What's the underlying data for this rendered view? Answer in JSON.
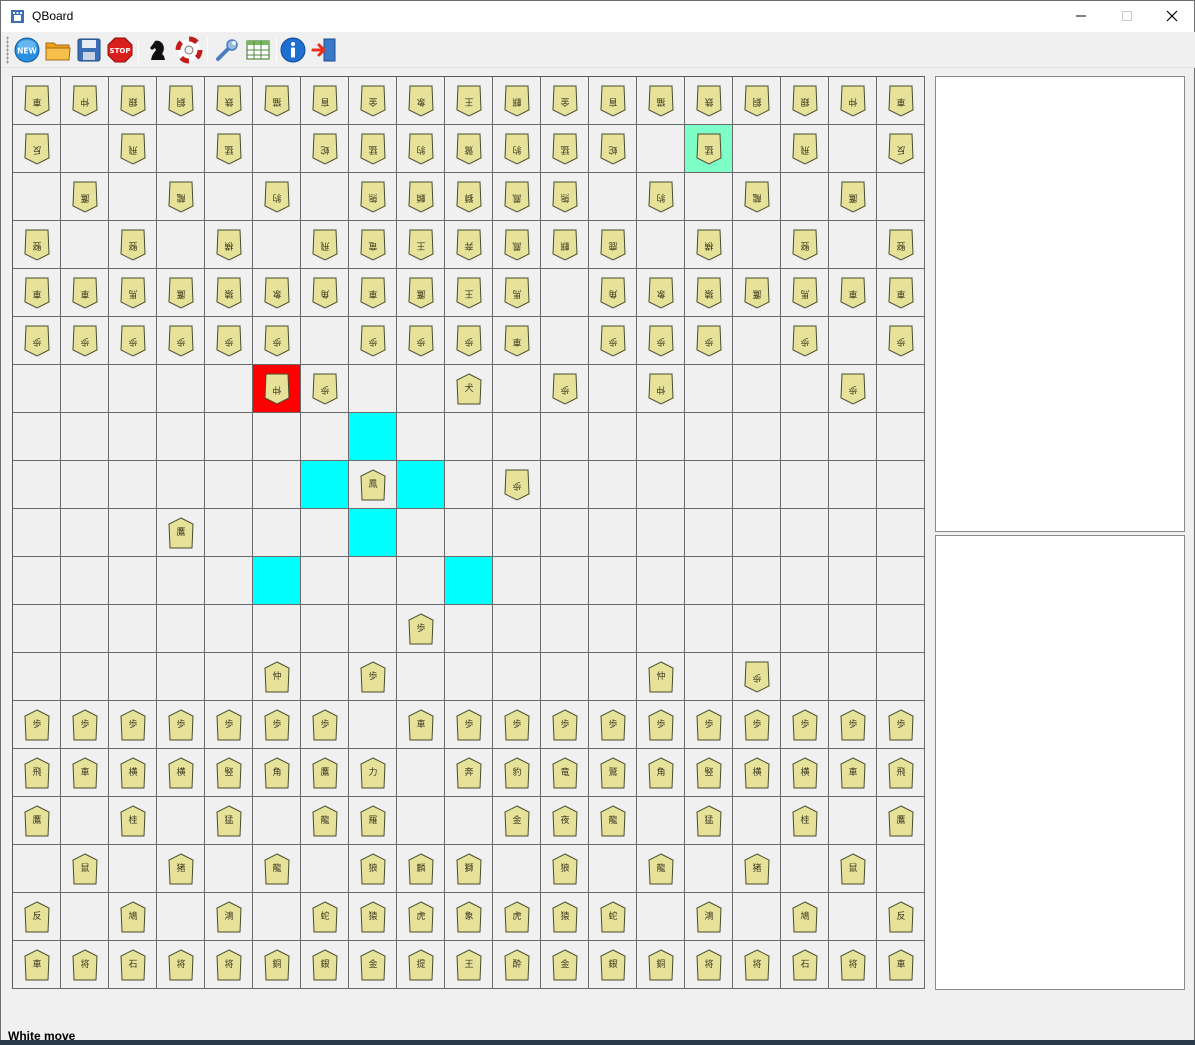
{
  "window": {
    "title": "QBoard",
    "buttons": [
      "minimize",
      "maximize",
      "close"
    ]
  },
  "toolbar": {
    "buttons": [
      {
        "name": "new-game-button",
        "icon": "new-icon",
        "label": "NEW"
      },
      {
        "name": "open-button",
        "icon": "folder-icon"
      },
      {
        "name": "save-button",
        "icon": "save-icon"
      },
      {
        "name": "stop-button",
        "icon": "stop-icon",
        "label": "STOP"
      },
      {
        "name": "engine-button",
        "icon": "knight-icon"
      },
      {
        "name": "flip-button",
        "icon": "lifebuoy-icon"
      },
      {
        "name": "settings-button",
        "icon": "wrench-icon"
      },
      {
        "name": "table-button",
        "icon": "table-icon"
      },
      {
        "name": "about-button",
        "icon": "info-icon"
      },
      {
        "name": "exit-button",
        "icon": "exit-icon"
      }
    ]
  },
  "board": {
    "files": 19,
    "ranks": 19,
    "highlights": {
      "cyan": [
        [
          7,
          7
        ],
        [
          8,
          6
        ],
        [
          8,
          8
        ],
        [
          9,
          7
        ],
        [
          10,
          5
        ],
        [
          10,
          9
        ]
      ],
      "red": [
        [
          6,
          5
        ]
      ],
      "green": [
        [
          1,
          14
        ]
      ]
    },
    "pieces": [
      {
        "r": 0,
        "c": 0,
        "s": "w",
        "k": "車"
      },
      {
        "r": 0,
        "c": 1,
        "s": "w",
        "k": "仲"
      },
      {
        "r": 0,
        "c": 2,
        "s": "w",
        "k": "銀"
      },
      {
        "r": 0,
        "c": 3,
        "s": "w",
        "k": "銅"
      },
      {
        "r": 0,
        "c": 4,
        "s": "w",
        "k": "鉄"
      },
      {
        "r": 0,
        "c": 5,
        "s": "w",
        "k": "猫"
      },
      {
        "r": 0,
        "c": 6,
        "s": "w",
        "k": "盲"
      },
      {
        "r": 0,
        "c": 7,
        "s": "w",
        "k": "金"
      },
      {
        "r": 0,
        "c": 8,
        "s": "w",
        "k": "象"
      },
      {
        "r": 0,
        "c": 9,
        "s": "w",
        "k": "王"
      },
      {
        "r": 0,
        "c": 10,
        "s": "w",
        "k": "麒"
      },
      {
        "r": 0,
        "c": 11,
        "s": "w",
        "k": "金"
      },
      {
        "r": 0,
        "c": 12,
        "s": "w",
        "k": "盲"
      },
      {
        "r": 0,
        "c": 13,
        "s": "w",
        "k": "猫"
      },
      {
        "r": 0,
        "c": 14,
        "s": "w",
        "k": "鉄"
      },
      {
        "r": 0,
        "c": 15,
        "s": "w",
        "k": "銅"
      },
      {
        "r": 0,
        "c": 16,
        "s": "w",
        "k": "銀"
      },
      {
        "r": 0,
        "c": 17,
        "s": "w",
        "k": "仲"
      },
      {
        "r": 0,
        "c": 18,
        "s": "w",
        "k": "車"
      },
      {
        "r": 1,
        "c": 0,
        "s": "w",
        "k": "反"
      },
      {
        "r": 1,
        "c": 2,
        "s": "w",
        "k": "飛"
      },
      {
        "r": 1,
        "c": 4,
        "s": "w",
        "k": "猛"
      },
      {
        "r": 1,
        "c": 6,
        "s": "w",
        "k": "蛇"
      },
      {
        "r": 1,
        "c": 7,
        "s": "w",
        "k": "猛"
      },
      {
        "r": 1,
        "c": 8,
        "s": "w",
        "k": "豹"
      },
      {
        "r": 1,
        "c": 9,
        "s": "w",
        "k": "鷲"
      },
      {
        "r": 1,
        "c": 10,
        "s": "w",
        "k": "豹"
      },
      {
        "r": 1,
        "c": 11,
        "s": "w",
        "k": "猛"
      },
      {
        "r": 1,
        "c": 12,
        "s": "w",
        "k": "蛇"
      },
      {
        "r": 1,
        "c": 14,
        "s": "w",
        "k": "猛"
      },
      {
        "r": 1,
        "c": 16,
        "s": "w",
        "k": "飛"
      },
      {
        "r": 1,
        "c": 18,
        "s": "w",
        "k": "反"
      },
      {
        "r": 2,
        "c": 1,
        "s": "w",
        "k": "鷹"
      },
      {
        "r": 2,
        "c": 3,
        "s": "w",
        "k": "龍"
      },
      {
        "r": 2,
        "c": 5,
        "s": "w",
        "k": "豹"
      },
      {
        "r": 2,
        "c": 7,
        "s": "w",
        "k": "熊"
      },
      {
        "r": 2,
        "c": 8,
        "s": "w",
        "k": "麟"
      },
      {
        "r": 2,
        "c": 9,
        "s": "w",
        "k": "獅"
      },
      {
        "r": 2,
        "c": 10,
        "s": "w",
        "k": "鳳"
      },
      {
        "r": 2,
        "c": 11,
        "s": "w",
        "k": "熊"
      },
      {
        "r": 2,
        "c": 13,
        "s": "w",
        "k": "豹"
      },
      {
        "r": 2,
        "c": 15,
        "s": "w",
        "k": "龍"
      },
      {
        "r": 2,
        "c": 17,
        "s": "w",
        "k": "鷹"
      },
      {
        "r": 3,
        "c": 0,
        "s": "w",
        "k": "竪"
      },
      {
        "r": 3,
        "c": 2,
        "s": "w",
        "k": "竪"
      },
      {
        "r": 3,
        "c": 4,
        "s": "w",
        "k": "横"
      },
      {
        "r": 3,
        "c": 6,
        "s": "w",
        "k": "飛"
      },
      {
        "r": 3,
        "c": 7,
        "s": "w",
        "k": "竜"
      },
      {
        "r": 3,
        "c": 8,
        "s": "w",
        "k": "王"
      },
      {
        "r": 3,
        "c": 9,
        "s": "w",
        "k": "奔"
      },
      {
        "r": 3,
        "c": 10,
        "s": "w",
        "k": "鳳"
      },
      {
        "r": 3,
        "c": 11,
        "s": "w",
        "k": "麒"
      },
      {
        "r": 3,
        "c": 12,
        "s": "w",
        "k": "鹿"
      },
      {
        "r": 3,
        "c": 14,
        "s": "w",
        "k": "横"
      },
      {
        "r": 3,
        "c": 16,
        "s": "w",
        "k": "竪"
      },
      {
        "r": 3,
        "c": 18,
        "s": "w",
        "k": "竪"
      },
      {
        "r": 4,
        "c": 0,
        "s": "w",
        "k": "車"
      },
      {
        "r": 4,
        "c": 1,
        "s": "w",
        "k": "車"
      },
      {
        "r": 4,
        "c": 2,
        "s": "w",
        "k": "馬"
      },
      {
        "r": 4,
        "c": 3,
        "s": "w",
        "k": "鷹"
      },
      {
        "r": 4,
        "c": 4,
        "s": "w",
        "k": "猿"
      },
      {
        "r": 4,
        "c": 5,
        "s": "w",
        "k": "象"
      },
      {
        "r": 4,
        "c": 6,
        "s": "w",
        "k": "角"
      },
      {
        "r": 4,
        "c": 7,
        "s": "w",
        "k": "車"
      },
      {
        "r": 4,
        "c": 8,
        "s": "w",
        "k": "鷹"
      },
      {
        "r": 4,
        "c": 9,
        "s": "w",
        "k": "王"
      },
      {
        "r": 4,
        "c": 10,
        "s": "w",
        "k": "馬"
      },
      {
        "r": 4,
        "c": 12,
        "s": "w",
        "k": "角"
      },
      {
        "r": 4,
        "c": 13,
        "s": "w",
        "k": "象"
      },
      {
        "r": 4,
        "c": 14,
        "s": "w",
        "k": "猿"
      },
      {
        "r": 4,
        "c": 15,
        "s": "w",
        "k": "鷹"
      },
      {
        "r": 4,
        "c": 16,
        "s": "w",
        "k": "馬"
      },
      {
        "r": 4,
        "c": 17,
        "s": "w",
        "k": "車"
      },
      {
        "r": 4,
        "c": 18,
        "s": "w",
        "k": "車"
      },
      {
        "r": 5,
        "c": 0,
        "s": "w",
        "k": "歩"
      },
      {
        "r": 5,
        "c": 1,
        "s": "w",
        "k": "歩"
      },
      {
        "r": 5,
        "c": 2,
        "s": "w",
        "k": "歩"
      },
      {
        "r": 5,
        "c": 3,
        "s": "w",
        "k": "歩"
      },
      {
        "r": 5,
        "c": 4,
        "s": "w",
        "k": "歩"
      },
      {
        "r": 5,
        "c": 5,
        "s": "w",
        "k": "歩"
      },
      {
        "r": 5,
        "c": 7,
        "s": "w",
        "k": "歩"
      },
      {
        "r": 5,
        "c": 8,
        "s": "w",
        "k": "歩"
      },
      {
        "r": 5,
        "c": 9,
        "s": "w",
        "k": "歩"
      },
      {
        "r": 5,
        "c": 10,
        "s": "w",
        "k": "車"
      },
      {
        "r": 5,
        "c": 12,
        "s": "w",
        "k": "歩"
      },
      {
        "r": 5,
        "c": 13,
        "s": "w",
        "k": "歩"
      },
      {
        "r": 5,
        "c": 14,
        "s": "w",
        "k": "歩"
      },
      {
        "r": 5,
        "c": 16,
        "s": "w",
        "k": "歩"
      },
      {
        "r": 5,
        "c": 18,
        "s": "w",
        "k": "歩"
      },
      {
        "r": 6,
        "c": 5,
        "s": "w",
        "k": "仲"
      },
      {
        "r": 6,
        "c": 6,
        "s": "w",
        "k": "歩"
      },
      {
        "r": 6,
        "c": 9,
        "s": "b",
        "k": "犬"
      },
      {
        "r": 6,
        "c": 11,
        "s": "w",
        "k": "歩"
      },
      {
        "r": 6,
        "c": 13,
        "s": "w",
        "k": "仲"
      },
      {
        "r": 6,
        "c": 17,
        "s": "w",
        "k": "歩"
      },
      {
        "r": 8,
        "c": 7,
        "s": "b",
        "k": "鳳"
      },
      {
        "r": 8,
        "c": 10,
        "s": "w",
        "k": "歩"
      },
      {
        "r": 9,
        "c": 3,
        "s": "b",
        "k": "鷹"
      },
      {
        "r": 11,
        "c": 8,
        "s": "b",
        "k": "歩"
      },
      {
        "r": 12,
        "c": 5,
        "s": "b",
        "k": "仲"
      },
      {
        "r": 12,
        "c": 7,
        "s": "b",
        "k": "歩"
      },
      {
        "r": 12,
        "c": 13,
        "s": "b",
        "k": "仲"
      },
      {
        "r": 12,
        "c": 15,
        "s": "w",
        "k": "歩"
      },
      {
        "r": 13,
        "c": 0,
        "s": "b",
        "k": "歩"
      },
      {
        "r": 13,
        "c": 1,
        "s": "b",
        "k": "歩"
      },
      {
        "r": 13,
        "c": 2,
        "s": "b",
        "k": "歩"
      },
      {
        "r": 13,
        "c": 3,
        "s": "b",
        "k": "歩"
      },
      {
        "r": 13,
        "c": 4,
        "s": "b",
        "k": "歩"
      },
      {
        "r": 13,
        "c": 5,
        "s": "b",
        "k": "歩"
      },
      {
        "r": 13,
        "c": 6,
        "s": "b",
        "k": "歩"
      },
      {
        "r": 13,
        "c": 8,
        "s": "b",
        "k": "車"
      },
      {
        "r": 13,
        "c": 9,
        "s": "b",
        "k": "歩"
      },
      {
        "r": 13,
        "c": 10,
        "s": "b",
        "k": "歩"
      },
      {
        "r": 13,
        "c": 11,
        "s": "b",
        "k": "歩"
      },
      {
        "r": 13,
        "c": 12,
        "s": "b",
        "k": "歩"
      },
      {
        "r": 13,
        "c": 13,
        "s": "b",
        "k": "歩"
      },
      {
        "r": 13,
        "c": 14,
        "s": "b",
        "k": "歩"
      },
      {
        "r": 13,
        "c": 15,
        "s": "b",
        "k": "歩"
      },
      {
        "r": 13,
        "c": 16,
        "s": "b",
        "k": "歩"
      },
      {
        "r": 13,
        "c": 17,
        "s": "b",
        "k": "歩"
      },
      {
        "r": 13,
        "c": 18,
        "s": "b",
        "k": "歩"
      },
      {
        "r": 14,
        "c": 0,
        "s": "b",
        "k": "飛"
      },
      {
        "r": 14,
        "c": 1,
        "s": "b",
        "k": "車"
      },
      {
        "r": 14,
        "c": 2,
        "s": "b",
        "k": "横"
      },
      {
        "r": 14,
        "c": 3,
        "s": "b",
        "k": "横"
      },
      {
        "r": 14,
        "c": 4,
        "s": "b",
        "k": "竪"
      },
      {
        "r": 14,
        "c": 5,
        "s": "b",
        "k": "角"
      },
      {
        "r": 14,
        "c": 6,
        "s": "b",
        "k": "鷹"
      },
      {
        "r": 14,
        "c": 7,
        "s": "b",
        "k": "力"
      },
      {
        "r": 14,
        "c": 9,
        "s": "b",
        "k": "奔"
      },
      {
        "r": 14,
        "c": 10,
        "s": "b",
        "k": "豹"
      },
      {
        "r": 14,
        "c": 11,
        "s": "b",
        "k": "竜"
      },
      {
        "r": 14,
        "c": 12,
        "s": "b",
        "k": "鷲"
      },
      {
        "r": 14,
        "c": 13,
        "s": "b",
        "k": "角"
      },
      {
        "r": 14,
        "c": 14,
        "s": "b",
        "k": "竪"
      },
      {
        "r": 14,
        "c": 15,
        "s": "b",
        "k": "横"
      },
      {
        "r": 14,
        "c": 16,
        "s": "b",
        "k": "横"
      },
      {
        "r": 14,
        "c": 17,
        "s": "b",
        "k": "車"
      },
      {
        "r": 14,
        "c": 18,
        "s": "b",
        "k": "飛"
      },
      {
        "r": 15,
        "c": 0,
        "s": "b",
        "k": "鷹"
      },
      {
        "r": 15,
        "c": 2,
        "s": "b",
        "k": "桂"
      },
      {
        "r": 15,
        "c": 4,
        "s": "b",
        "k": "猛"
      },
      {
        "r": 15,
        "c": 6,
        "s": "b",
        "k": "龍"
      },
      {
        "r": 15,
        "c": 7,
        "s": "b",
        "k": "羅"
      },
      {
        "r": 15,
        "c": 10,
        "s": "b",
        "k": "金"
      },
      {
        "r": 15,
        "c": 11,
        "s": "b",
        "k": "夜"
      },
      {
        "r": 15,
        "c": 12,
        "s": "b",
        "k": "龍"
      },
      {
        "r": 15,
        "c": 14,
        "s": "b",
        "k": "猛"
      },
      {
        "r": 15,
        "c": 16,
        "s": "b",
        "k": "桂"
      },
      {
        "r": 15,
        "c": 18,
        "s": "b",
        "k": "鷹"
      },
      {
        "r": 16,
        "c": 1,
        "s": "b",
        "k": "鼠"
      },
      {
        "r": 16,
        "c": 3,
        "s": "b",
        "k": "猪"
      },
      {
        "r": 16,
        "c": 5,
        "s": "b",
        "k": "龍"
      },
      {
        "r": 16,
        "c": 7,
        "s": "b",
        "k": "狼"
      },
      {
        "r": 16,
        "c": 8,
        "s": "b",
        "k": "麟"
      },
      {
        "r": 16,
        "c": 9,
        "s": "b",
        "k": "獅"
      },
      {
        "r": 16,
        "c": 11,
        "s": "b",
        "k": "狼"
      },
      {
        "r": 16,
        "c": 13,
        "s": "b",
        "k": "龍"
      },
      {
        "r": 16,
        "c": 15,
        "s": "b",
        "k": "猪"
      },
      {
        "r": 16,
        "c": 17,
        "s": "b",
        "k": "鼠"
      },
      {
        "r": 17,
        "c": 0,
        "s": "b",
        "k": "反"
      },
      {
        "r": 17,
        "c": 2,
        "s": "b",
        "k": "鳩"
      },
      {
        "r": 17,
        "c": 4,
        "s": "b",
        "k": "鴻"
      },
      {
        "r": 17,
        "c": 6,
        "s": "b",
        "k": "蛇"
      },
      {
        "r": 17,
        "c": 7,
        "s": "b",
        "k": "猿"
      },
      {
        "r": 17,
        "c": 8,
        "s": "b",
        "k": "虎"
      },
      {
        "r": 17,
        "c": 9,
        "s": "b",
        "k": "象"
      },
      {
        "r": 17,
        "c": 10,
        "s": "b",
        "k": "虎"
      },
      {
        "r": 17,
        "c": 11,
        "s": "b",
        "k": "猿"
      },
      {
        "r": 17,
        "c": 12,
        "s": "b",
        "k": "蛇"
      },
      {
        "r": 17,
        "c": 14,
        "s": "b",
        "k": "鴻"
      },
      {
        "r": 17,
        "c": 16,
        "s": "b",
        "k": "鳩"
      },
      {
        "r": 17,
        "c": 18,
        "s": "b",
        "k": "反"
      },
      {
        "r": 18,
        "c": 0,
        "s": "b",
        "k": "車"
      },
      {
        "r": 18,
        "c": 1,
        "s": "b",
        "k": "将"
      },
      {
        "r": 18,
        "c": 2,
        "s": "b",
        "k": "石"
      },
      {
        "r": 18,
        "c": 3,
        "s": "b",
        "k": "将"
      },
      {
        "r": 18,
        "c": 4,
        "s": "b",
        "k": "将"
      },
      {
        "r": 18,
        "c": 5,
        "s": "b",
        "k": "銅"
      },
      {
        "r": 18,
        "c": 6,
        "s": "b",
        "k": "銀"
      },
      {
        "r": 18,
        "c": 7,
        "s": "b",
        "k": "金"
      },
      {
        "r": 18,
        "c": 8,
        "s": "b",
        "k": "提"
      },
      {
        "r": 18,
        "c": 9,
        "s": "b",
        "k": "王"
      },
      {
        "r": 18,
        "c": 10,
        "s": "b",
        "k": "酔"
      },
      {
        "r": 18,
        "c": 11,
        "s": "b",
        "k": "金"
      },
      {
        "r": 18,
        "c": 12,
        "s": "b",
        "k": "銀"
      },
      {
        "r": 18,
        "c": 13,
        "s": "b",
        "k": "銅"
      },
      {
        "r": 18,
        "c": 14,
        "s": "b",
        "k": "将"
      },
      {
        "r": 18,
        "c": 15,
        "s": "b",
        "k": "将"
      },
      {
        "r": 18,
        "c": 16,
        "s": "b",
        "k": "石"
      },
      {
        "r": 18,
        "c": 17,
        "s": "b",
        "k": "将"
      },
      {
        "r": 18,
        "c": 18,
        "s": "b",
        "k": "車"
      }
    ]
  },
  "colors": {
    "piece_fill": "#e6e29a",
    "piece_stroke": "#4a4a30",
    "highlight_cyan": "#00ffff",
    "highlight_red": "#ff0000",
    "highlight_green": "#7fffc8"
  },
  "status": {
    "text": "White move"
  }
}
